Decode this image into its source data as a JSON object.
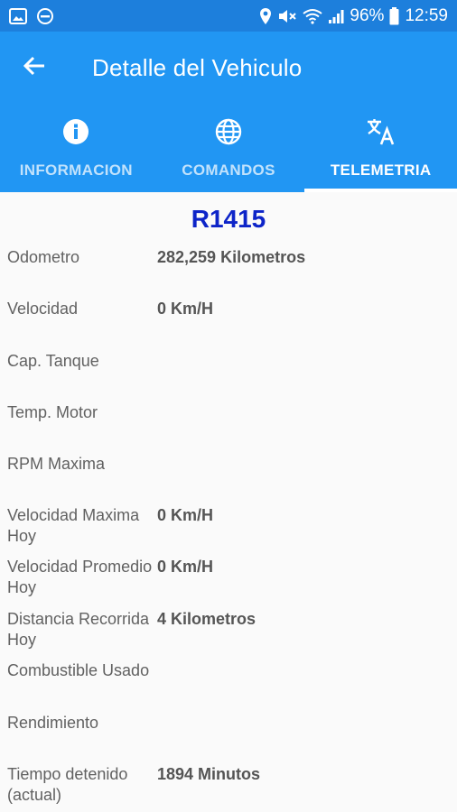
{
  "status_bar": {
    "battery": "96%",
    "time": "12:59",
    "icons": [
      "image-icon",
      "do-not-disturb-icon",
      "location-icon",
      "mute-icon",
      "wifi-icon",
      "signal-icon",
      "battery-icon"
    ]
  },
  "app_bar": {
    "title": "Detalle del Vehiculo",
    "back_icon": "arrow-back-icon"
  },
  "tabs": [
    {
      "label": "INFORMACION",
      "icon": "info-icon",
      "active": false
    },
    {
      "label": "COMANDOS",
      "icon": "globe-icon",
      "active": false
    },
    {
      "label": "TELEMETRIA",
      "icon": "translate-icon",
      "active": true
    }
  ],
  "vehicle": {
    "id": "R1415"
  },
  "telemetry": [
    {
      "label": "Odometro",
      "value": "282,259 Kilometros"
    },
    {
      "label": "Velocidad",
      "value": "0 Km/H"
    },
    {
      "label": "Cap. Tanque",
      "value": ""
    },
    {
      "label": "Temp. Motor",
      "value": ""
    },
    {
      "label": "RPM Maxima",
      "value": ""
    },
    {
      "label": "Velocidad Maxima Hoy",
      "value": "0 Km/H"
    },
    {
      "label": "Velocidad Promedio Hoy",
      "value": "0 Km/H"
    },
    {
      "label": "Distancia Recorrida Hoy",
      "value": "4 Kilometros"
    },
    {
      "label": "Combustible Usado",
      "value": ""
    },
    {
      "label": "Rendimiento",
      "value": ""
    },
    {
      "label": "Tiempo detenido (actual)",
      "value": "1894  Minutos"
    }
  ],
  "colors": {
    "primary": "#2196f3",
    "status_bar": "#1d7fdc",
    "vehicle_id": "#0d24c8"
  }
}
